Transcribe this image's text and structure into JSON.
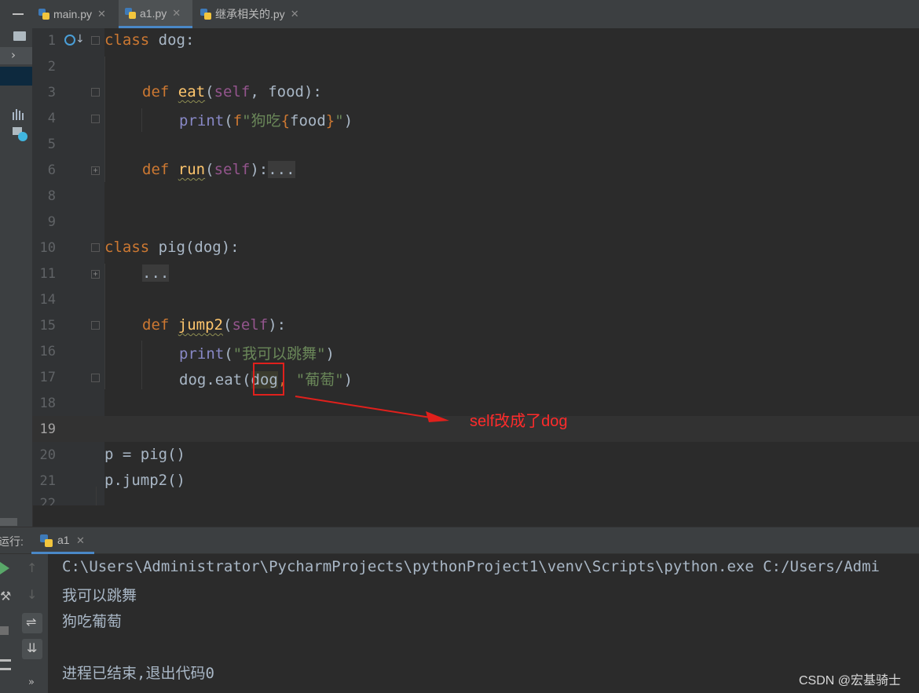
{
  "tabs": [
    {
      "label": "main.py",
      "active": false
    },
    {
      "label": "a1.py",
      "active": true
    },
    {
      "label": "继承相关的.py",
      "active": false
    }
  ],
  "editor": {
    "lines": [
      {
        "n": "1"
      },
      {
        "n": "2"
      },
      {
        "n": "3"
      },
      {
        "n": "4"
      },
      {
        "n": "5"
      },
      {
        "n": "6"
      },
      {
        "n": "8"
      },
      {
        "n": "9"
      },
      {
        "n": "10"
      },
      {
        "n": "11"
      },
      {
        "n": "14"
      },
      {
        "n": "15"
      },
      {
        "n": "16"
      },
      {
        "n": "17"
      },
      {
        "n": "18"
      },
      {
        "n": "19"
      },
      {
        "n": "20"
      },
      {
        "n": "21"
      },
      {
        "n": "22"
      }
    ],
    "code": {
      "l1_kw": "class",
      "l1_rest": " dog:",
      "l3_kw": "def",
      "l3_fn": "eat",
      "l3_p1": "(",
      "l3_self": "self",
      "l3_rest": ", food):",
      "l4_bi": "print",
      "l4_p": "(",
      "l4_f": "f",
      "l4_s1": "\"狗吃",
      "l4_b1": "{",
      "l4_var": "food",
      "l4_b2": "}",
      "l4_s2": "\"",
      "l4_end": ")",
      "l6_kw": "def",
      "l6_fn": "run",
      "l6_p1": "(",
      "l6_self": "self",
      "l6_p2": "):",
      "l6_fold": "...",
      "l10_kw": "class",
      "l10_rest": " pig(dog):",
      "l11_fold": "...",
      "l15_kw": "def",
      "l15_fn": "jump2",
      "l15_p1": "(",
      "l15_self": "self",
      "l15_p2": "):",
      "l16_bi": "print",
      "l16_p": "(",
      "l16_s": "\"我可以跳舞\"",
      "l16_end": ")",
      "l17_a": "dog.eat(",
      "l17_arg": "dog",
      "l17_comma": ",",
      "l17_sp": " ",
      "l17_s": "\"葡萄\"",
      "l17_end": ")",
      "l20": "p = pig()",
      "l21": "p.jump2()"
    }
  },
  "annotation": {
    "text": "self改成了dog",
    "color": "#ff2b2b"
  },
  "run": {
    "label": "运行:",
    "tab": "a1",
    "output": [
      "C:\\Users\\Administrator\\PycharmProjects\\pythonProject1\\venv\\Scripts\\python.exe C:/Users/Admi",
      "我可以跳舞",
      "狗吃葡萄",
      "",
      "进程已结束,退出代码0"
    ]
  },
  "watermark": "CSDN @宏基骑士",
  "colors": {
    "keyword": "#cc7832",
    "function": "#ffc66d",
    "self": "#94558d",
    "builtin": "#8888c6",
    "string": "#6a8759",
    "text": "#a9b7c6",
    "accent": "#4a88c7"
  }
}
